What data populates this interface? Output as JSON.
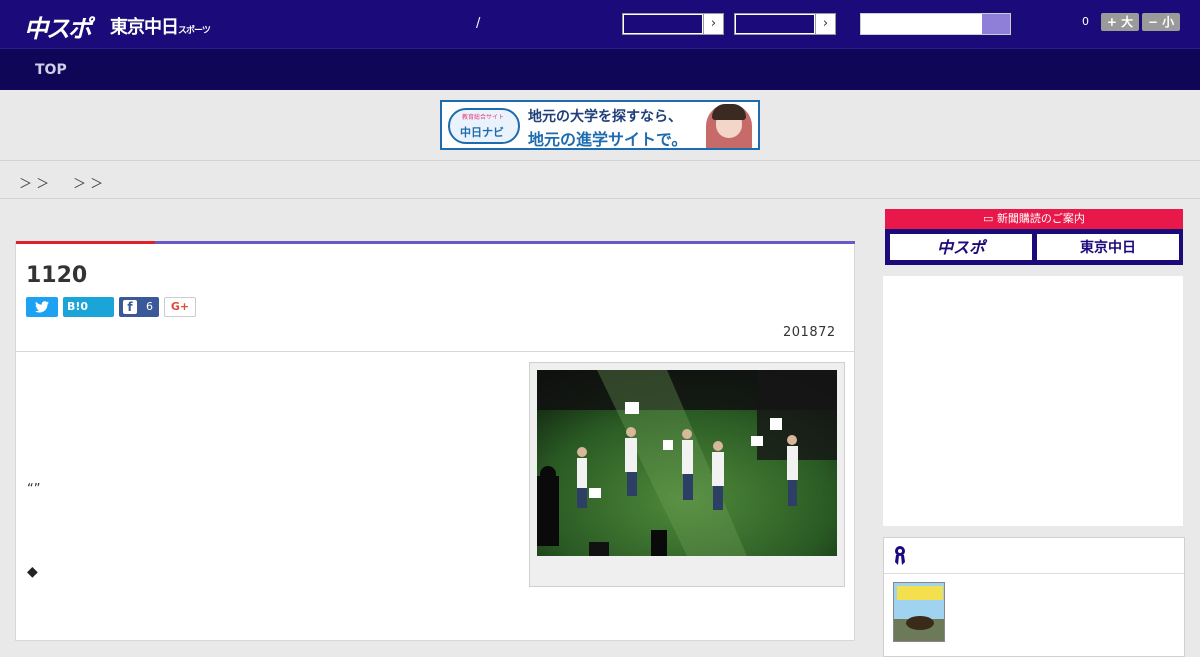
{
  "header": {
    "logo_main": "中スポ",
    "logo_sub": "東京中日",
    "logo_sub_small": "スポーツ",
    "separator": "/",
    "notification_count": "0",
    "font_larger_label": "+ 大",
    "font_smaller_label": "− 小"
  },
  "nav": {
    "top_label": "TOP"
  },
  "banner": {
    "badge_label": "教育総合サイト",
    "badge_text": "中日ナビ",
    "line1": "地元の大学を探すなら、",
    "line2": "地元の進学サイトで。"
  },
  "breadcrumb": {
    "sep1": "＞ ＞",
    "sep2": "＞ ＞"
  },
  "article": {
    "title": "1120",
    "share": {
      "hatena_label": "B!",
      "hatena_count": "0",
      "facebook_count": "6",
      "gplus_label": "G+"
    },
    "date": "201872",
    "quote_marks": "“”",
    "diamond": "◆"
  },
  "sidebar": {
    "subscribe_label": "新聞購読のご案内",
    "logo_a": "中スポ",
    "logo_b": "東京中日"
  },
  "colors": {
    "header_bg": "#1a0a7a",
    "nav_bg": "#0f0658",
    "accent_red": "#e0212c",
    "accent_purple": "#6a58c4"
  }
}
